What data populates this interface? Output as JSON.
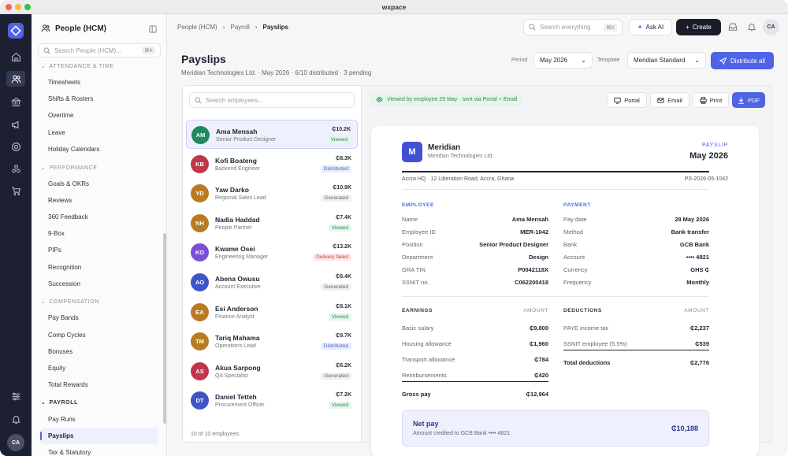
{
  "window": {
    "title": "wxpace"
  },
  "sidebar": {
    "title": "People (HCM)",
    "search_placeholder": "Search People (HCM)...",
    "search_kbd": "⌘K",
    "sections": [
      {
        "label": "ATTENDANCE & TIME",
        "items": [
          "Timesheets",
          "Shifts & Rosters",
          "Overtime",
          "Leave",
          "Holiday Calendars"
        ]
      },
      {
        "label": "PERFORMANCE",
        "items": [
          "Goals & OKRs",
          "Reviews",
          "360 Feedback",
          "9-Box",
          "PIPs",
          "Recognition",
          "Succession"
        ]
      },
      {
        "label": "COMPENSATION",
        "items": [
          "Pay Bands",
          "Comp Cycles",
          "Bonuses",
          "Equity",
          "Total Rewards"
        ]
      },
      {
        "label": "PAYROLL",
        "items": [
          "Pay Runs",
          "Payslips",
          "Tax & Statutory"
        ]
      }
    ],
    "active_item": "Payslips"
  },
  "rail": {
    "avatar": "CA"
  },
  "topbar": {
    "breadcrumb": [
      "People (HCM)",
      "Payroll",
      "Payslips"
    ],
    "search_placeholder": "Search everything",
    "search_kbd": "⌘K",
    "ask_ai": "Ask AI",
    "create": "Create",
    "avatar": "CA"
  },
  "page": {
    "title": "Payslips",
    "subtitle": "Meridian Technologies Ltd. · May 2026 · 6/10 distributed · 3 pending",
    "period_label": "Period",
    "period_value": "May 2026",
    "template_label": "Template",
    "template_value": "Meridian Standard",
    "distribute_all": "Distribute all"
  },
  "employees": {
    "search_placeholder": "Search employees...",
    "footer": "10 of 10 employees",
    "rows": [
      {
        "initials": "AM",
        "name": "Ama Mensah",
        "role": "Senior Product Designer",
        "amount": "₵10.2K",
        "status": "Viewed",
        "status_class": "viewed",
        "color": "#1f8a5c"
      },
      {
        "initials": "KB",
        "name": "Kofi Boateng",
        "role": "Backend Engineer",
        "amount": "₵8.3K",
        "status": "Distributed",
        "status_class": "distributed",
        "color": "#c0364a"
      },
      {
        "initials": "YD",
        "name": "Yaw Darko",
        "role": "Regional Sales Lead",
        "amount": "₵10.9K",
        "status": "Generated",
        "status_class": "generated",
        "color": "#b97b22"
      },
      {
        "initials": "NH",
        "name": "Nadia Haddad",
        "role": "People Partner",
        "amount": "₵7.4K",
        "status": "Viewed",
        "status_class": "viewed",
        "color": "#b97b22"
      },
      {
        "initials": "KO",
        "name": "Kwame Osei",
        "role": "Engineering Manager",
        "amount": "₵13.2K",
        "status": "Delivery failed",
        "status_class": "failed",
        "color": "#7b4fd6"
      },
      {
        "initials": "AO",
        "name": "Abena Owusu",
        "role": "Account Executive",
        "amount": "₵6.4K",
        "status": "Generated",
        "status_class": "generated",
        "color": "#3f55c6"
      },
      {
        "initials": "EA",
        "name": "Esi Anderson",
        "role": "Finance Analyst",
        "amount": "₵8.1K",
        "status": "Viewed",
        "status_class": "viewed",
        "color": "#b97b22"
      },
      {
        "initials": "TM",
        "name": "Tariq Mahama",
        "role": "Operations Lead",
        "amount": "₵9.7K",
        "status": "Distributed",
        "status_class": "distributed",
        "color": "#b97b22"
      },
      {
        "initials": "AS",
        "name": "Akua Sarpong",
        "role": "QA Specialist",
        "amount": "₵6.2K",
        "status": "Generated",
        "status_class": "generated",
        "color": "#c0364a"
      },
      {
        "initials": "DT",
        "name": "Daniel Tetteh",
        "role": "Procurement Officer",
        "amount": "₵7.2K",
        "status": "Viewed",
        "status_class": "viewed",
        "color": "#3f55c6"
      }
    ]
  },
  "preview": {
    "viewed_banner": "Viewed by employee 29 May · sent via Portal + Email",
    "buttons": {
      "portal": "Portal",
      "email": "Email",
      "print": "Print",
      "pdf": "PDF"
    },
    "company": "Meridian",
    "company_legal": "Meridian Technologies Ltd.",
    "payslip_label": "PAYSLIP",
    "payslip_month": "May 2026",
    "address": "Accra HQ · 12 Liberation Road, Accra, Ghana",
    "doc_id": "PS-2026-05-1042",
    "employee_title": "EMPLOYEE",
    "employee": [
      {
        "k": "Name",
        "v": "Ama Mensah"
      },
      {
        "k": "Employee ID",
        "v": "MER-1042"
      },
      {
        "k": "Position",
        "v": "Senior Product Designer"
      },
      {
        "k": "Department",
        "v": "Design"
      },
      {
        "k": "GRA TIN",
        "v": "P0042118X"
      },
      {
        "k": "SSNIT no.",
        "v": "C062200418"
      }
    ],
    "payment_title": "PAYMENT",
    "payment": [
      {
        "k": "Pay date",
        "v": "28 May 2026"
      },
      {
        "k": "Method",
        "v": "Bank transfer"
      },
      {
        "k": "Bank",
        "v": "GCB Bank"
      },
      {
        "k": "Account",
        "v": "•••• 4821"
      },
      {
        "k": "Currency",
        "v": "GHS ₵"
      },
      {
        "k": "Frequency",
        "v": "Monthly"
      }
    ],
    "earnings_title": "EARNINGS",
    "amount_header": "AMOUNT",
    "earnings": [
      {
        "k": "Basic salary",
        "v": "₵9,800"
      },
      {
        "k": "Housing allowance",
        "v": "₵1,960"
      },
      {
        "k": "Transport allowance",
        "v": "₵784"
      },
      {
        "k": "Reimbursements",
        "v": "₵420"
      }
    ],
    "gross_label": "Gross pay",
    "gross_value": "₵12,964",
    "deductions_title": "DEDUCTIONS",
    "deductions": [
      {
        "k": "PAYE income tax",
        "v": "₵2,237"
      },
      {
        "k": "SSNIT employee (5.5%)",
        "v": "₵539"
      }
    ],
    "total_deductions_label": "Total deductions",
    "total_deductions_value": "₵2,776",
    "net_label": "Net pay",
    "net_sub": "Amount credited to GCB Bank •••• 4821",
    "net_value": "₵10,188"
  }
}
